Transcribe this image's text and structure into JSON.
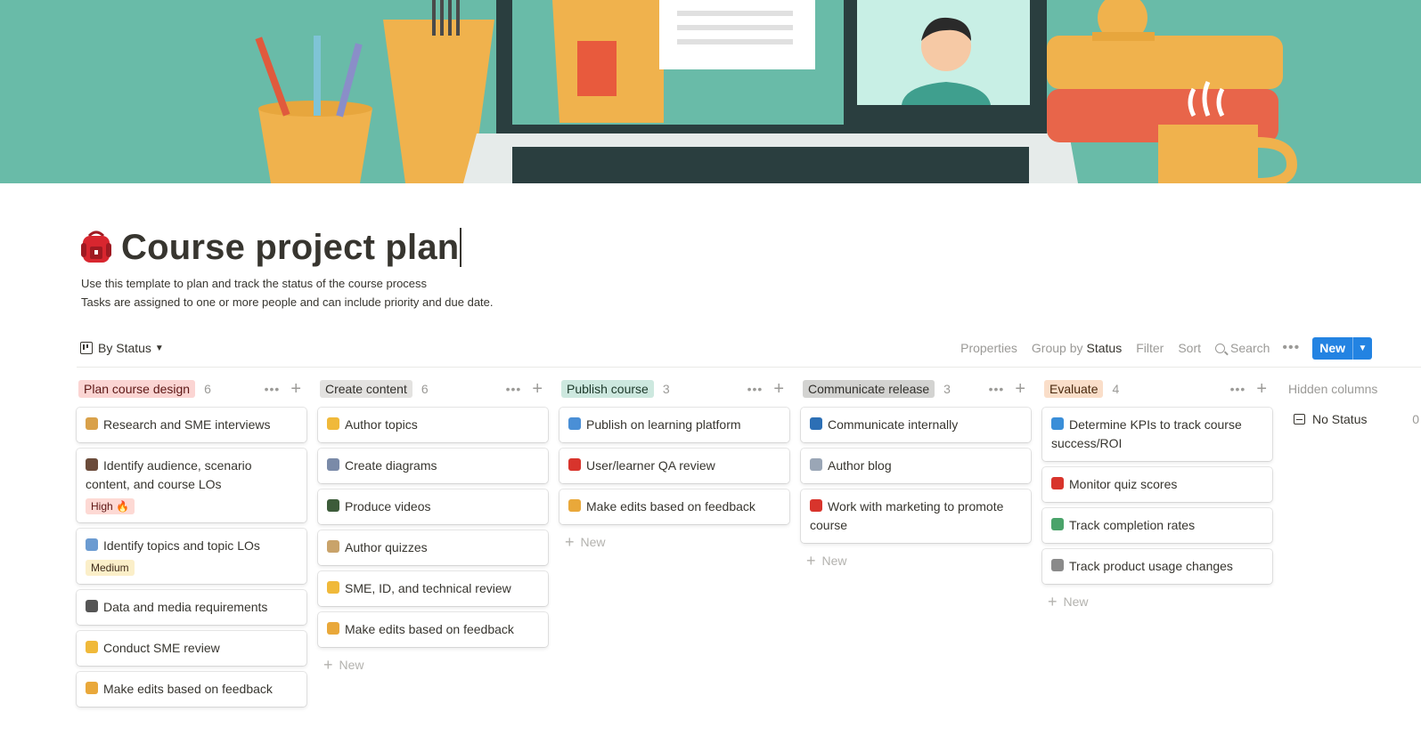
{
  "page": {
    "icon": "backpack-icon",
    "title": "Course project plan",
    "description": [
      "Use this template to plan and track the status of the course process",
      "Tasks are assigned to one or more people and can include priority and due date."
    ]
  },
  "toolbar": {
    "view_label": "By Status",
    "properties": "Properties",
    "group_by_prefix": "Group by",
    "group_by_value": "Status",
    "filter": "Filter",
    "sort": "Sort",
    "search": "Search",
    "more": "•••",
    "new_label": "New",
    "new_button_color": "#2383e2"
  },
  "board": {
    "add_new_label": "New",
    "columns": [
      {
        "label": "Plan course design",
        "count": "6",
        "tag_bg": "#fbd5d3",
        "tag_color": "#5d1715",
        "cards": [
          {
            "title": "Research and SME interviews",
            "icon": "books-icon",
            "icon_color": "#d9a14a"
          },
          {
            "title": "Identify audience, scenario content, and course LOs",
            "icon": "person-icon",
            "icon_color": "#6b4b3a",
            "badge": "High 🔥",
            "badge_bg": "#fdd9d4",
            "badge_color": "#5d1715"
          },
          {
            "title": "Identify topics and topic LOs",
            "icon": "magnifier-icon",
            "icon_color": "#6b9bd1",
            "badge": "Medium",
            "badge_bg": "#fbefc9",
            "badge_color": "#402c1b"
          },
          {
            "title": "Data and media requirements",
            "icon": "camera-icon",
            "icon_color": "#555555"
          },
          {
            "title": "Conduct SME review",
            "icon": "nerd-face-icon",
            "icon_color": "#f0b93a"
          },
          {
            "title": "Make edits based on feedback",
            "icon": "notebook-icon",
            "icon_color": "#e9a83a"
          }
        ]
      },
      {
        "label": "Create content",
        "count": "6",
        "tag_bg": "#e3e2e0",
        "tag_color": "#32302c",
        "cards": [
          {
            "title": "Author topics",
            "icon": "writing-hand-icon",
            "icon_color": "#f0b93a"
          },
          {
            "title": "Create diagrams",
            "icon": "bar-chart-icon",
            "icon_color": "#7a8aa8"
          },
          {
            "title": "Produce videos",
            "icon": "clapper-icon",
            "icon_color": "#3d5c3a"
          },
          {
            "title": "Author quizzes",
            "icon": "memo-icon",
            "icon_color": "#c9a36a"
          },
          {
            "title": "SME, ID, and technical review",
            "icon": "nerd-face-icon",
            "icon_color": "#f0b93a"
          },
          {
            "title": "Make edits based on feedback",
            "icon": "notebook-icon",
            "icon_color": "#e9a83a"
          }
        ],
        "show_add": true
      },
      {
        "label": "Publish course",
        "count": "3",
        "tag_bg": "#cde8df",
        "tag_color": "#1c3829",
        "cards": [
          {
            "title": "Publish on learning platform",
            "icon": "computer-icon",
            "icon_color": "#4a8fd6"
          },
          {
            "title": "User/learner QA review",
            "icon": "question-icon",
            "icon_color": "#d8342c"
          },
          {
            "title": "Make edits based on feedback",
            "icon": "notebook-icon",
            "icon_color": "#e9a83a"
          }
        ],
        "show_add": true
      },
      {
        "label": "Communicate release",
        "count": "3",
        "tag_bg": "#d3d3d1",
        "tag_color": "#32302c",
        "cards": [
          {
            "title": "Communicate internally",
            "icon": "megaphone-icon",
            "icon_color": "#2c6fb5"
          },
          {
            "title": "Author blog",
            "icon": "newspaper-icon",
            "icon_color": "#9aa6b6"
          },
          {
            "title": "Work with marketing to promote course",
            "icon": "siren-icon",
            "icon_color": "#d8342c"
          }
        ],
        "show_add": true
      },
      {
        "label": "Evaluate",
        "count": "4",
        "tag_bg": "#fadec9",
        "tag_color": "#49290e",
        "cards": [
          {
            "title": "Determine KPIs to track course success/ROI",
            "icon": "diamond-icon",
            "icon_color": "#3a8ed8"
          },
          {
            "title": "Monitor quiz scores",
            "icon": "chart-up-icon",
            "icon_color": "#d8342c"
          },
          {
            "title": "Track completion rates",
            "icon": "picture-icon",
            "icon_color": "#4aa36a"
          },
          {
            "title": "Track product usage changes",
            "icon": "mouse-icon",
            "icon_color": "#8a8a8a"
          }
        ],
        "show_add": true
      }
    ],
    "hidden_columns_label": "Hidden columns",
    "hidden": [
      {
        "label": "No Status",
        "count": "0",
        "icon": "inbox-icon"
      }
    ]
  }
}
